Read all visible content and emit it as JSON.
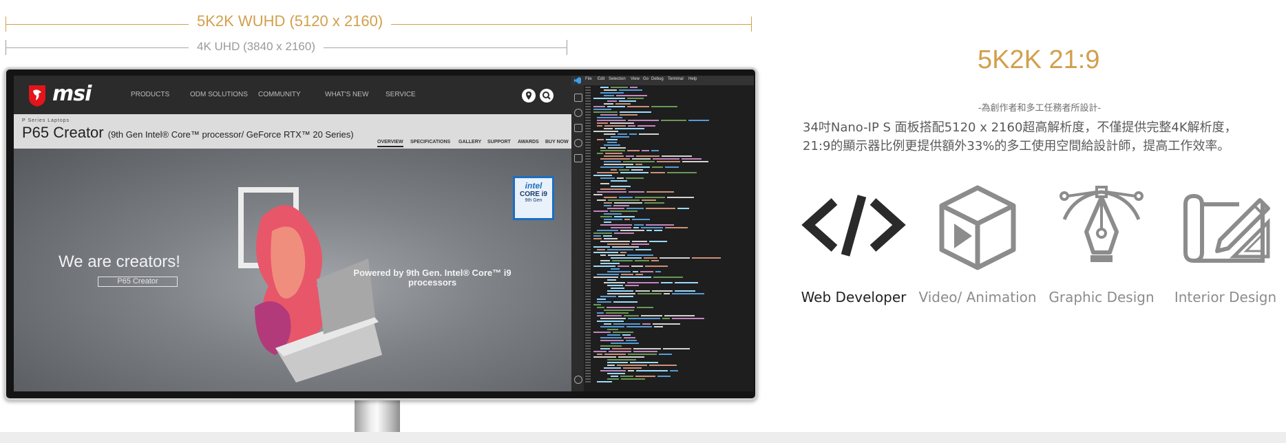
{
  "resolution": {
    "wuhd_label": "5K2K WUHD (5120 x 2160)",
    "uhd_label": "4K UHD (3840 x 2160)",
    "wuhd_color": "#d1a04c",
    "uhd_color": "#9a9a9a"
  },
  "screen": {
    "nav": {
      "brand": "msi",
      "items": [
        "PRODUCTS",
        "ODM SOLUTIONS",
        "COMMUNITY",
        "WHAT'S NEW",
        "SERVICE"
      ],
      "icons": [
        "location-pin-icon",
        "search-icon"
      ]
    },
    "product": {
      "series": "P Series Laptops",
      "name": "P65 Creator",
      "spec": "(9th Gen Intel® Core™ processor/ GeForce RTX™ 20 Series)",
      "tabs": [
        "OVERVIEW",
        "SPECIFICATIONS",
        "GALLERY",
        "SUPPORT",
        "AWARDS",
        "BUY NOW"
      ],
      "active_tab": "OVERVIEW"
    },
    "hero": {
      "headline": "We are creators!",
      "box_label": "P65 Creator",
      "powered_by": "Powered by 9th Gen. Intel® Core™ i9 processors",
      "badge": {
        "brand": "intel",
        "line1": "CORE i9",
        "line2": "9th Gen"
      }
    },
    "ide": {
      "menu": [
        "File",
        "Edit",
        "Selection",
        "View",
        "Go",
        "Debug",
        "Terminal",
        "Help"
      ],
      "activity_icons": [
        "files-icon",
        "search-icon",
        "branch-icon",
        "debug-icon",
        "extensions-icon",
        "settings-icon"
      ]
    }
  },
  "info": {
    "title": "5K2K 21:9",
    "subtitle": "-為創作者和多工任務者所設計-",
    "description_line1": "34吋Nano-IP S 面板搭配5120 x 2160超高解析度，不僅提供完整4K解析度，",
    "description_line2": "21:9的顯示器比例更提供額外33%的多工使用空間給設計師，提高工作效率。",
    "categories": [
      {
        "label": "Web Developer",
        "icon": "code-icon",
        "active": true
      },
      {
        "label": "Video/ Animation",
        "icon": "video-cube-icon",
        "active": false
      },
      {
        "label": "Graphic Design",
        "icon": "pen-tool-icon",
        "active": false
      },
      {
        "label": "Interior Design",
        "icon": "blueprint-icon",
        "active": false
      }
    ]
  }
}
